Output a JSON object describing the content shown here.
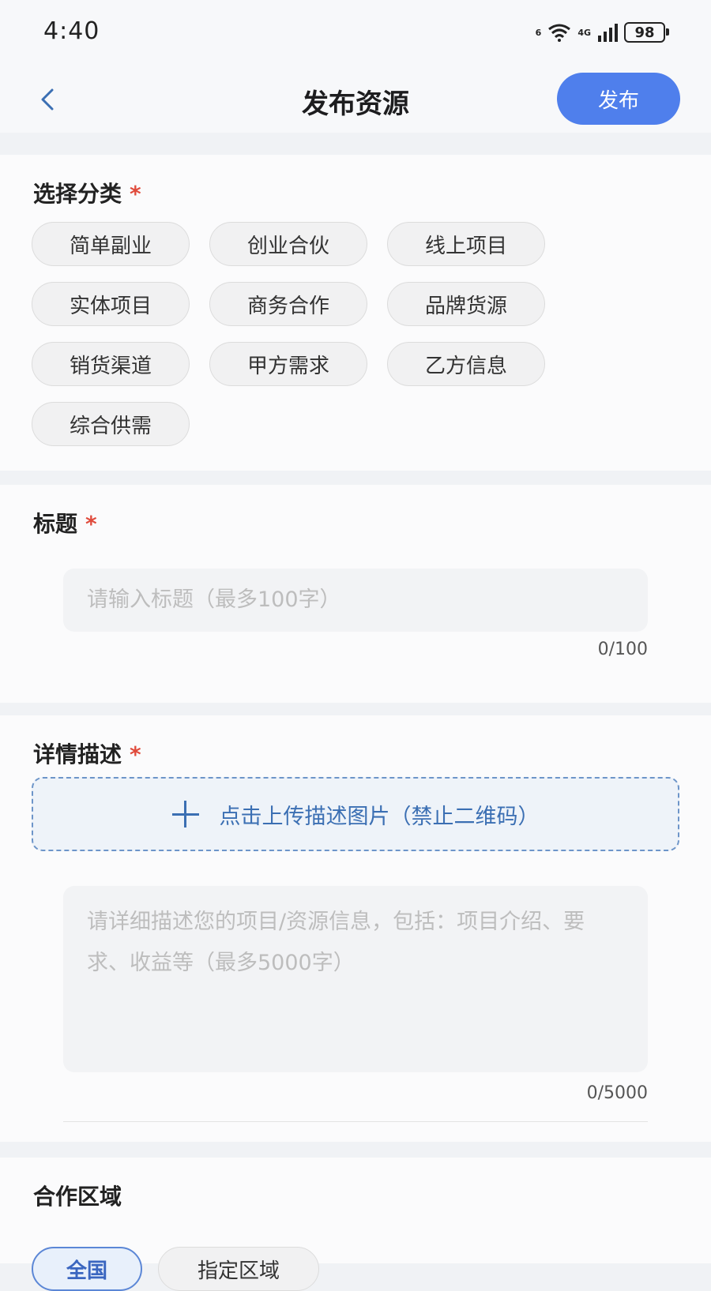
{
  "status_bar": {
    "time": "4:40",
    "network": "4G",
    "sim": "6",
    "battery": "98"
  },
  "header": {
    "title": "发布资源",
    "publish_label": "发布"
  },
  "category": {
    "title": "选择分类",
    "required_mark": "*",
    "options": [
      "简单副业",
      "创业合伙",
      "线上项目",
      "实体项目",
      "商务合作",
      "品牌货源",
      "销货渠道",
      "甲方需求",
      "乙方信息",
      "综合供需"
    ]
  },
  "title_field": {
    "label": "标题",
    "required_mark": "*",
    "placeholder": "请输入标题（最多100字）",
    "counter": "0/100"
  },
  "description": {
    "label": "详情描述",
    "required_mark": "*",
    "upload_label": "点击上传描述图片（禁止二维码）",
    "placeholder": "请详细描述您的项目/资源信息，包括：项目介绍、要求、收益等（最多5000字）",
    "counter": "0/5000"
  },
  "region": {
    "label": "合作区域",
    "options": [
      "全国",
      "指定区域"
    ],
    "selected": "全国"
  },
  "colors": {
    "accent": "#4f7fec",
    "required": "#e04b3c",
    "upload": "#3b6fb3"
  }
}
